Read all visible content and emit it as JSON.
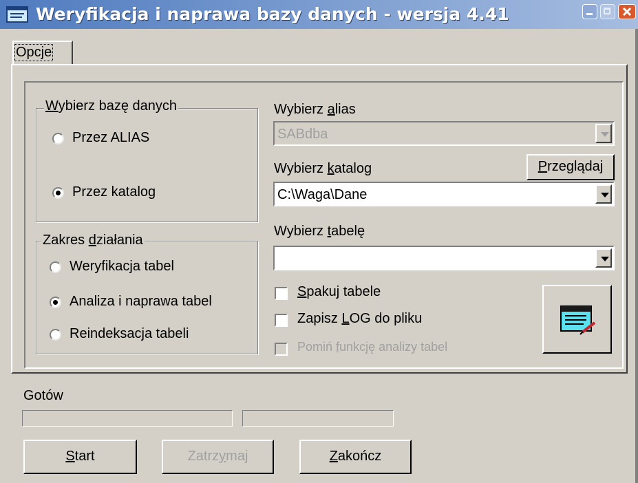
{
  "window": {
    "title": "Weryfikacja i naprawa bazy danych - wersja 4.41"
  },
  "tab": {
    "label": "Opcje"
  },
  "select_db": {
    "title_pre": "",
    "title_key": "W",
    "title_post": "ybierz bazę danych",
    "options": [
      {
        "label": "Przez ALIAS",
        "checked": false
      },
      {
        "label": "Przez katalog",
        "checked": true
      }
    ]
  },
  "alias": {
    "label_pre": "Wybierz ",
    "label_key": "a",
    "label_post": "lias",
    "value": "SABdba",
    "enabled": false
  },
  "catalog": {
    "label_pre": "Wybierz ",
    "label_key": "k",
    "label_post": "atalog",
    "value": "C:\\Waga\\Dane",
    "browse_pre": "",
    "browse_key": "P",
    "browse_post": "rzeglądaj"
  },
  "table": {
    "label_pre": "Wybierz ",
    "label_key": "t",
    "label_post": "abelę",
    "value": ""
  },
  "scope": {
    "title_pre": "Zakres ",
    "title_key": "d",
    "title_post": "ziałania",
    "options": [
      {
        "label": "Weryfikacja tabel",
        "checked": false
      },
      {
        "label": "Analiza i naprawa tabel",
        "checked": true
      },
      {
        "label": "Reindeksacja tabeli",
        "checked": false
      }
    ]
  },
  "checks": [
    {
      "pre": "",
      "key": "S",
      "post": "pakuj tabele",
      "checked": false,
      "enabled": true
    },
    {
      "pre": "Zapisz ",
      "key": "L",
      "post": "OG do pliku",
      "checked": false,
      "enabled": true
    },
    {
      "pre": "Pomiń ",
      "key": "f",
      "post": "unkcję analizy tabel",
      "checked": false,
      "enabled": false
    }
  ],
  "status": {
    "text": "Gotów"
  },
  "progress": {
    "bar1": 0,
    "bar2": 0
  },
  "buttons": {
    "start_key": "S",
    "start_post": "tart",
    "stop_pre": "Zatrz",
    "stop_key": "y",
    "stop_post": "maj",
    "close_key": "Z",
    "close_post": "akończ"
  },
  "colors": {
    "face": "#d4d0c8",
    "title_start": "#4f7bbf",
    "title_end": "#a6bde0",
    "disabled_text": "#a0a0a0"
  },
  "icons": {
    "app": "notepad-icon",
    "action": "notepad-icon"
  }
}
